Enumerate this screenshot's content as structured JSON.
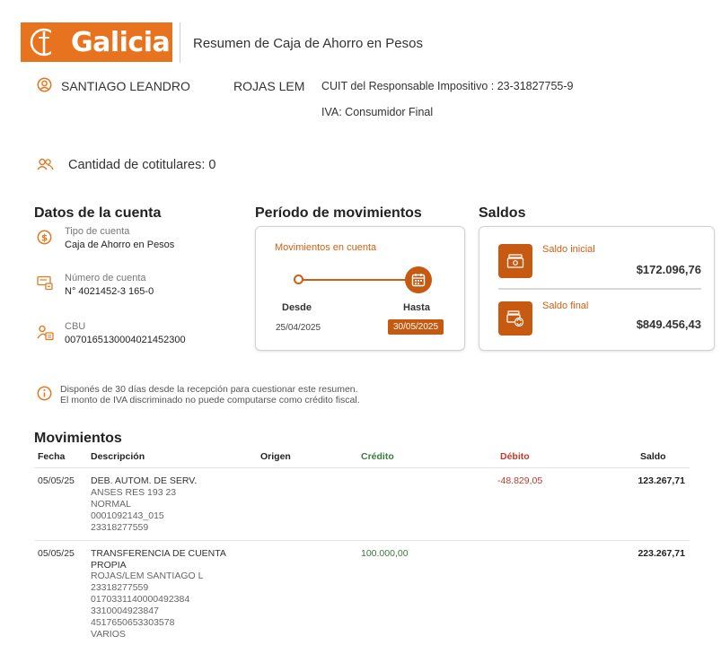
{
  "header": {
    "brand": "Galicia",
    "title": "Resumen de Caja de Ahorro en Pesos"
  },
  "holder": {
    "first_name": "SANTIAGO LEANDRO",
    "last_name": "ROJAS LEM",
    "cuit_label": "CUIT del Responsable Impositivo : 23-31827755-9",
    "iva_label": "IVA: Consumidor Final",
    "cotitulares": "Cantidad de cotitulares: 0"
  },
  "account": {
    "section_title": "Datos de la cuenta",
    "type_label": "Tipo de cuenta",
    "type_value": "Caja de Ahorro en Pesos",
    "number_label": "Número de cuenta",
    "number_value": "N° 4021452-3 165-0",
    "cbu_label": "CBU",
    "cbu_value": "0070165130004021452300"
  },
  "period": {
    "section_title": "Período de movimientos",
    "card_title": "Movimientos en cuenta",
    "from_label": "Desde",
    "from_date": "25/04/2025",
    "to_label": "Hasta",
    "to_date": "30/05/2025"
  },
  "balances": {
    "section_title": "Saldos",
    "initial_label": "Saldo inicial",
    "initial_value": "$172.096,76",
    "final_label": "Saldo final",
    "final_value": "$849.456,43"
  },
  "notice": {
    "line1": "Disponés de 30 días desde la recepción para cuestionar este resumen.",
    "line2": "El monto de IVA discriminado no puede computarse como crédito fiscal."
  },
  "movements": {
    "section_title": "Movimientos",
    "columns": {
      "date": "Fecha",
      "description": "Descripción",
      "origin": "Origen",
      "credit": "Crédito",
      "debit": "Débito",
      "balance": "Saldo"
    },
    "rows": [
      {
        "date": "05/05/25",
        "title": "DEB. AUTOM. DE SERV.",
        "details": [
          "ANSES RES 193 23",
          "NORMAL",
          "0001092143_015",
          "23318277559"
        ],
        "credit": "",
        "debit": "-48.829,05",
        "balance": "123.267,71"
      },
      {
        "date": "05/05/25",
        "title": "TRANSFERENCIA DE CUENTA PROPIA",
        "details": [
          "ROJAS/LEM SANTIAGO L",
          "23318277559",
          "0170331140000492384",
          "3310004923847",
          "4517650653303578",
          "VARIOS"
        ],
        "credit": "100.000,00",
        "debit": "",
        "balance": "223.267,71"
      }
    ]
  },
  "colors": {
    "brand_orange": "#e8731f",
    "accent_dark_orange": "#c65a10",
    "credit_green": "#3a7a3a",
    "debit_red": "#c0392b"
  }
}
